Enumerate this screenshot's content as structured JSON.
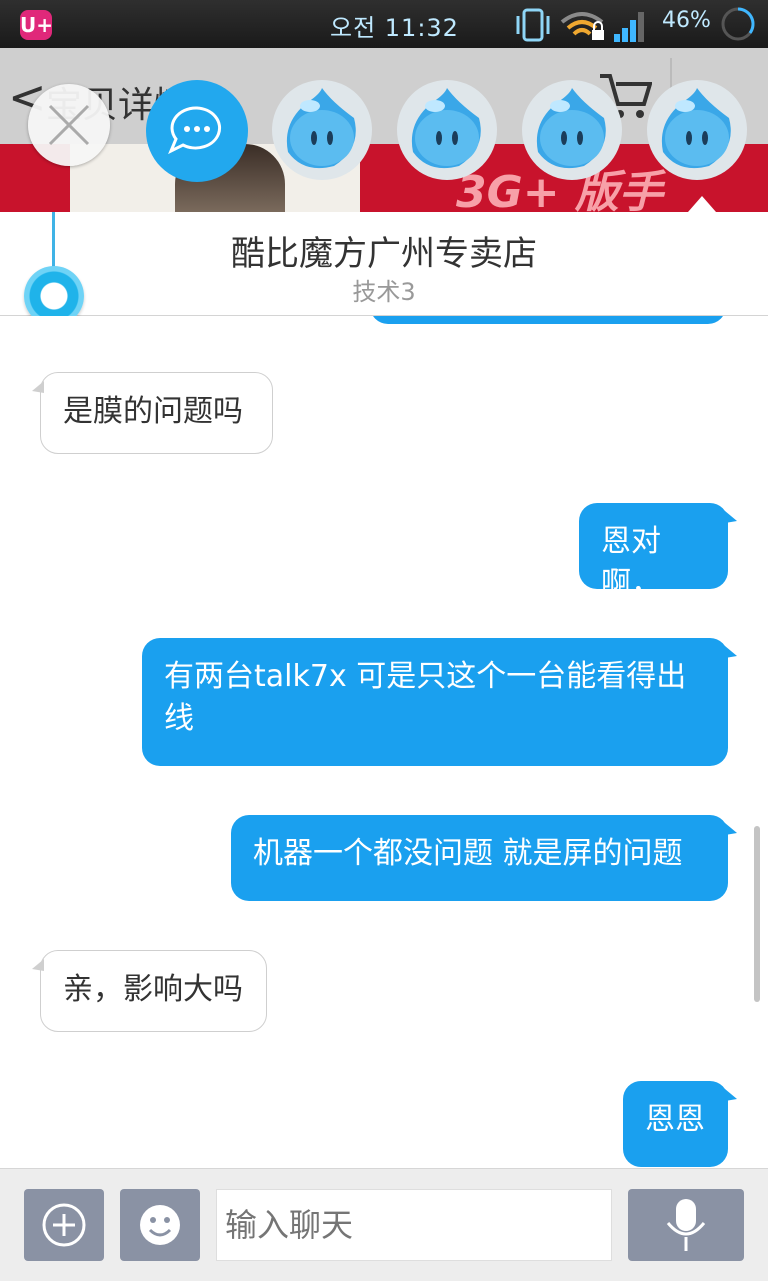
{
  "status_bar": {
    "carrier": "U+",
    "time": "오전 11:32",
    "battery": "46%"
  },
  "app_bar": {
    "back_glyph": "<",
    "title": "宝贝详情"
  },
  "banner": {
    "text": "3G+ 版手"
  },
  "chat_header": {
    "shop_name": "酷比魔方广州专卖店",
    "agent": "技术3"
  },
  "messages": [
    {
      "side": "in",
      "text": "是膜的问题吗"
    },
    {
      "side": "out",
      "text": "恩对啊，"
    },
    {
      "side": "out",
      "text": "有两台talk7x 可是只这个一台能看得出线"
    },
    {
      "side": "out",
      "text": "机器一个都没问题 就是屏的问题"
    },
    {
      "side": "in",
      "text": "亲，影响大吗"
    },
    {
      "side": "out",
      "text": "恩恩"
    }
  ],
  "input_bar": {
    "placeholder": "输入聊天"
  },
  "icons": {
    "close": "close-icon",
    "chat": "chat-bubble-icon",
    "mascot": "aliwangwang-mascot-icon",
    "add": "plus-circle-icon",
    "emoji": "smiley-icon",
    "mic": "microphone-icon",
    "cart": "cart-icon"
  },
  "colors": {
    "accent": "#1aa0ef",
    "carrier": "#e0287a",
    "tool_button": "#8a92a4"
  }
}
